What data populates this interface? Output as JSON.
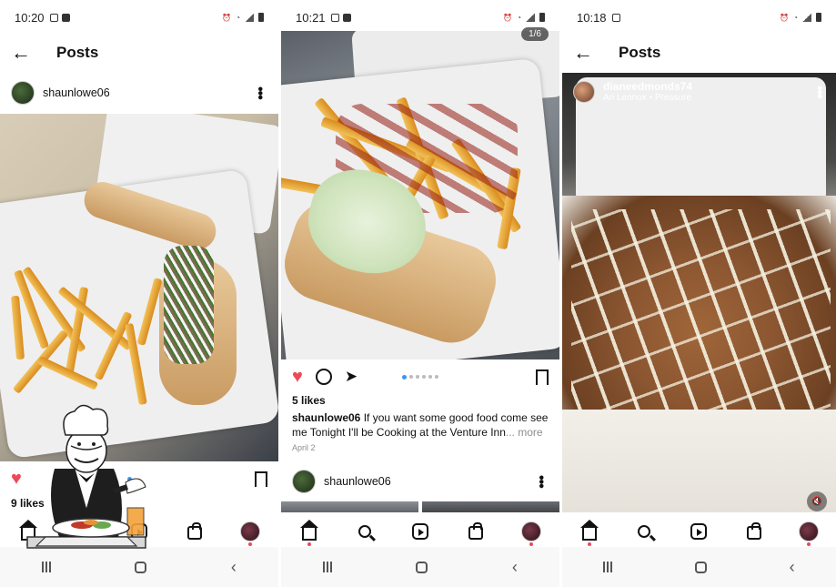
{
  "panels": [
    {
      "status": {
        "time": "10:20"
      },
      "topbar": {
        "title": "Posts"
      },
      "post": {
        "username": "shaunlowe06",
        "likes": "9 likes"
      }
    },
    {
      "status": {
        "time": "10:21"
      },
      "post": {
        "counter": "1/6",
        "likes": "5 likes",
        "caption_user": "shaunlowe06",
        "caption_text": " If you want some good food come see me Tonight I'll be Cooking at the Venture Inn",
        "caption_more": "... more",
        "date": "April 2",
        "page_count": 6,
        "page_active": 0
      },
      "next_post": {
        "username": "shaunlowe06"
      }
    },
    {
      "status": {
        "time": "10:18"
      },
      "topbar": {
        "title": "Posts"
      },
      "reel": {
        "username": "dianeedmonds74",
        "audio": "Ari Lennox • Pressure"
      }
    }
  ],
  "colors": {
    "like_red": "#ed4956",
    "active_dot": "#3897f0",
    "muted_text": "#8e8e8e"
  },
  "icons": [
    "back-arrow-icon",
    "more-icon",
    "heart-icon",
    "comment-icon",
    "send-icon",
    "bookmark-icon",
    "home-icon",
    "search-icon",
    "reels-icon",
    "shop-icon",
    "profile-avatar",
    "recents-icon",
    "home-square-icon",
    "back-icon",
    "mute-icon"
  ]
}
